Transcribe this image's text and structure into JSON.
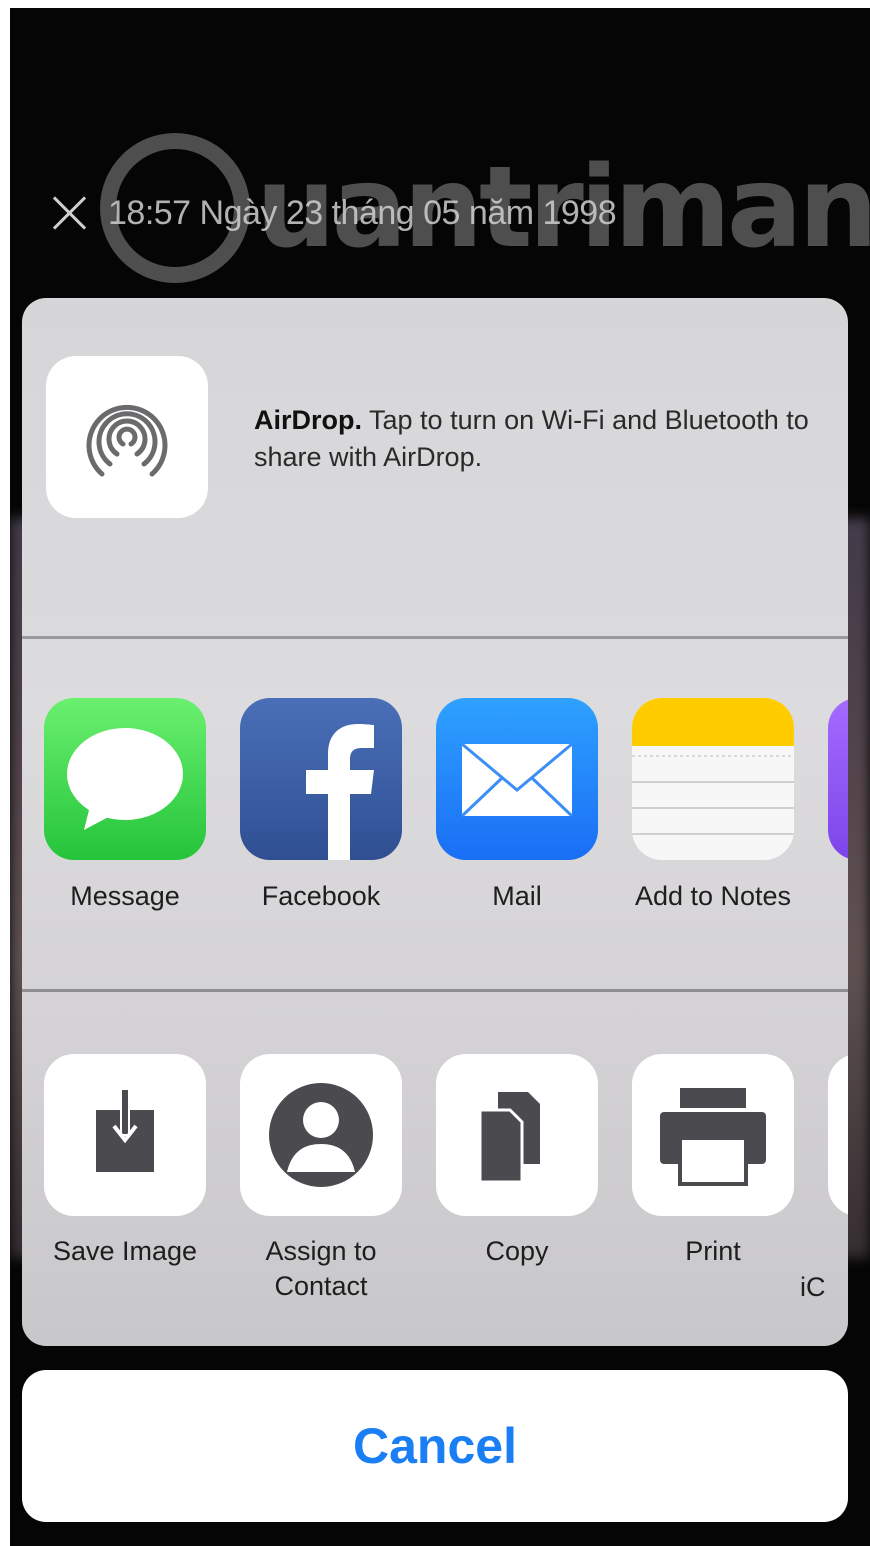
{
  "viewer": {
    "date_text": "18:57 Ngày 23 tháng 05 năm 1998",
    "watermark": "uantrimang",
    "close_icon": "close-icon"
  },
  "airdrop": {
    "title": "AirDrop.",
    "description": "Tap to turn on Wi-Fi and Bluetooth to share with AirDrop.",
    "icon": "airdrop-icon"
  },
  "apps": [
    {
      "label": "Message",
      "icon": "messages-icon"
    },
    {
      "label": "Facebook",
      "icon": "facebook-icon"
    },
    {
      "label": "Mail",
      "icon": "mail-icon"
    },
    {
      "label": "Add to Notes",
      "icon": "notes-icon"
    }
  ],
  "actions": [
    {
      "label": "Save Image",
      "icon": "save-image-icon"
    },
    {
      "label": "Assign to Contact",
      "icon": "contact-icon"
    },
    {
      "label": "Copy",
      "icon": "copy-icon"
    },
    {
      "label": "Print",
      "icon": "print-icon"
    },
    {
      "label": "iC"
    }
  ],
  "cancel_label": "Cancel",
  "colors": {
    "accent": "#1a7ef5",
    "sheet_bg": "#d8d8da",
    "message_green": "#34c759",
    "facebook_blue": "#3b5998",
    "mail_blue": "#1f8bff",
    "notes_yellow": "#ffcc00"
  }
}
